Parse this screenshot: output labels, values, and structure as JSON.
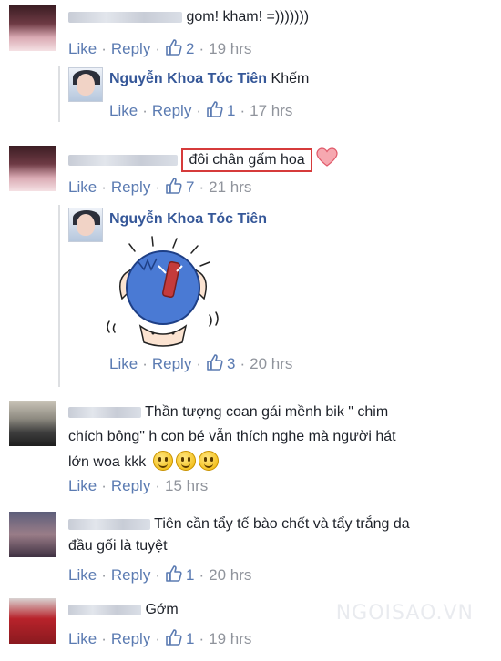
{
  "comments": [
    {
      "text": "gom! kham! =)))))))",
      "actions": {
        "like": "Like",
        "reply": "Reply",
        "likes": "2",
        "time": "19 hrs"
      },
      "reply": {
        "author": "Nguyễn Khoa Tóc Tiên",
        "text": "Khếm",
        "actions": {
          "like": "Like",
          "reply": "Reply",
          "likes": "1",
          "time": "17 hrs"
        }
      }
    },
    {
      "text": "đôi chân gấm hoa",
      "actions": {
        "like": "Like",
        "reply": "Reply",
        "likes": "7",
        "time": "21 hrs"
      },
      "reply": {
        "author": "Nguyễn Khoa Tóc Tiên",
        "sticker": "flexing-sticker",
        "actions": {
          "like": "Like",
          "reply": "Reply",
          "likes": "3",
          "time": "20 hrs"
        }
      }
    },
    {
      "text_line1": "Thần tượng coan gái mềnh bik \" chim",
      "text_line2": "chích bông\" h con bé vẫn thích nghe mà người hát",
      "text_line3": "lớn woa kkk",
      "actions": {
        "like": "Like",
        "reply": "Reply",
        "time": "15 hrs"
      }
    },
    {
      "text_line1": "Tiên cần tẩy tế bào chết và tẩy trắng da",
      "text_line2": "đầu gối là tuyệt",
      "actions": {
        "like": "Like",
        "reply": "Reply",
        "likes": "1",
        "time": "20 hrs"
      }
    },
    {
      "text": "Gớm",
      "actions": {
        "like": "Like",
        "reply": "Reply",
        "likes": "1",
        "time": "19 hrs"
      }
    }
  ],
  "watermark": "NGOISAO.VN",
  "colors": {
    "link": "#365899",
    "meta": "#90949c",
    "highlight": "#d63b3b"
  },
  "icons": [
    "thumbs-up-icon",
    "heart-icon",
    "smiley-icon"
  ]
}
